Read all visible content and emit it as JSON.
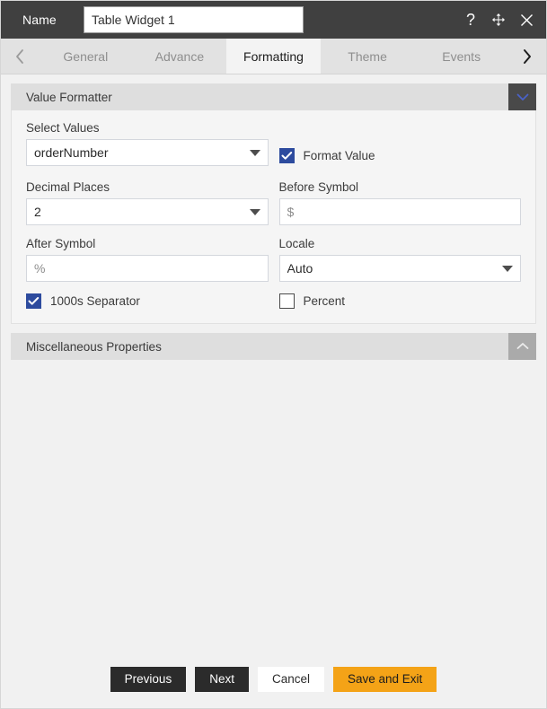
{
  "titlebar": {
    "name_label": "Name",
    "widget_name": "Table Widget 1",
    "help_icon": "question-mark-icon",
    "move_icon": "move-arrows-icon",
    "close_icon": "close-icon"
  },
  "tabstrip": {
    "prev_arrow": "chevron-left-icon",
    "next_arrow": "chevron-right-icon",
    "tabs": [
      {
        "label": "General",
        "active": false
      },
      {
        "label": "Advance",
        "active": false
      },
      {
        "label": "Formatting",
        "active": true
      },
      {
        "label": "Theme",
        "active": false
      },
      {
        "label": "Events",
        "active": false
      }
    ]
  },
  "sections": {
    "value_formatter": {
      "title": "Value Formatter",
      "collapse_icon": "chevron-down-icon",
      "fields": {
        "select_values": {
          "label": "Select Values",
          "value": "orderNumber"
        },
        "format_value": {
          "label": "Format Value",
          "checked": true
        },
        "decimal_places": {
          "label": "Decimal Places",
          "value": "2"
        },
        "before_symbol": {
          "label": "Before Symbol",
          "value": "",
          "placeholder": "$"
        },
        "after_symbol": {
          "label": "After Symbol",
          "value": "",
          "placeholder": "%"
        },
        "locale": {
          "label": "Locale",
          "value": "Auto"
        },
        "thousands_separator": {
          "label": "1000s Separator",
          "checked": true
        },
        "percent": {
          "label": "Percent",
          "checked": false
        }
      }
    },
    "misc_properties": {
      "title": "Miscellaneous Properties",
      "collapse_icon": "chevron-up-icon"
    }
  },
  "footer": {
    "previous_label": "Previous",
    "next_label": "Next",
    "cancel_label": "Cancel",
    "save_exit_label": "Save and Exit"
  },
  "colors": {
    "titlebar_bg": "#404040",
    "accent_orange": "#f4a317",
    "checkbox_blue": "#2d4b9e",
    "collapse_chevron_blue": "#4a62c8",
    "panel_bg": "#f1f1f1"
  }
}
